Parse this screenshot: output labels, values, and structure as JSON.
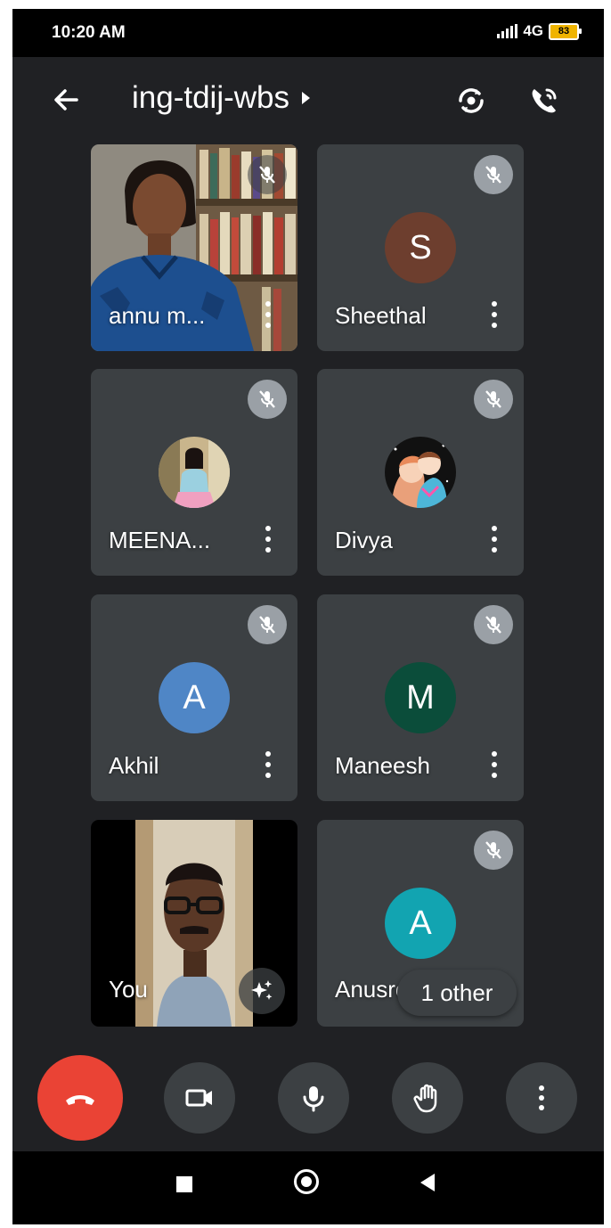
{
  "status_bar": {
    "time": "10:20 AM",
    "network": "4G",
    "battery": "83"
  },
  "header": {
    "meeting_code": "ing-tdij-wbs"
  },
  "tiles": [
    {
      "name": "annu m...",
      "type": "video",
      "muted": true
    },
    {
      "name": "Sheethal",
      "type": "initial",
      "initial": "S",
      "color": "#6d3e2e",
      "muted": true
    },
    {
      "name": "MEENA...",
      "type": "photo",
      "muted": true
    },
    {
      "name": "Divya",
      "type": "photo",
      "muted": true
    },
    {
      "name": "Akhil",
      "type": "initial",
      "initial": "A",
      "color": "#4f86c6",
      "muted": true
    },
    {
      "name": "Maneesh",
      "type": "initial",
      "initial": "M",
      "color": "#0b4d3a",
      "muted": true
    },
    {
      "name": "You",
      "type": "video",
      "muted": false
    },
    {
      "name": "Anusree",
      "type": "initial",
      "initial": "A",
      "color": "#12a4b1",
      "muted": true
    }
  ],
  "overflow_chip": {
    "label": "1 other"
  },
  "controls": {
    "end_call": "phone-hangup-icon",
    "camera": "video-camera-icon",
    "mic": "microphone-icon",
    "raise_hand": "raise-hand-icon",
    "more": "more-vertical-icon"
  }
}
